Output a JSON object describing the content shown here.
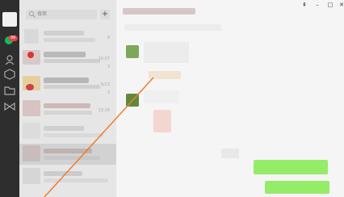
{
  "search": {
    "placeholder": "搜索"
  },
  "list": {
    "badge": "99",
    "add_label": "+",
    "rows": [
      {
        "time": "6",
        "sub": ""
      },
      {
        "time": "16:07",
        "sub": "3"
      },
      {
        "time": "6/13",
        "sub": "3"
      },
      {
        "time": "23:26",
        "sub": ""
      }
    ]
  },
  "window": {
    "pin": "⇞",
    "minimize": "–",
    "maximize": "□",
    "close": "✕"
  },
  "colors": {
    "rail": "#2e2e2e",
    "list": "#e6e6e6",
    "chat": "#f5f5f5",
    "bubble_green": "#95ec69",
    "arrow": "#ee7d2b"
  }
}
